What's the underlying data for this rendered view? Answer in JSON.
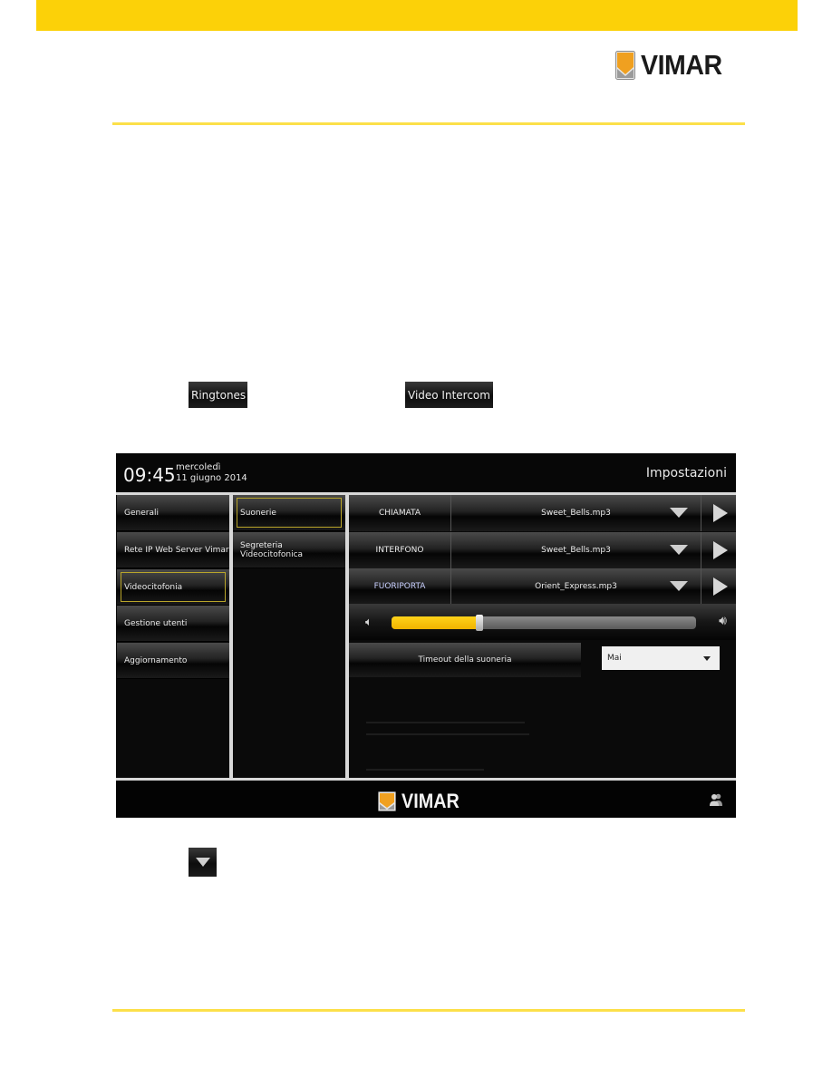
{
  "document": {
    "brand": "VIMAR",
    "inline_buttons": {
      "ringtones": "Ringtones",
      "video_intercom": "Video Intercom",
      "dropdown_icon": "chevron-down-icon"
    },
    "colors": {
      "brand_yellow": "#fcd108",
      "rule_yellow": "#fce04a"
    }
  },
  "device": {
    "status_bar": {
      "time": "09:45",
      "weekday": "mercoledì",
      "date": "11 giugno 2014",
      "title": "Impostazioni"
    },
    "main_menu": [
      {
        "label": "Generali",
        "selected": false
      },
      {
        "label": "Rete IP Web Server Vimar",
        "selected": false
      },
      {
        "label": "Videocitofonia",
        "selected": true
      },
      {
        "label": "Gestione utenti",
        "selected": false
      },
      {
        "label": "Aggiornamento",
        "selected": false
      }
    ],
    "sub_menu": [
      {
        "label": "Suonerie",
        "selected": true
      },
      {
        "label": "Segreteria Videocitofonica",
        "selected": false
      }
    ],
    "ringtones": [
      {
        "label": "CHIAMATA",
        "file": "Sweet_Bells.mp3"
      },
      {
        "label": "INTERFONO",
        "file": "Sweet_Bells.mp3"
      },
      {
        "label": "FUORIPORTA",
        "file": "Orient_Express.mp3"
      }
    ],
    "volume": {
      "level_percent": 29
    },
    "timeout": {
      "label": "Timeout della suoneria",
      "value": "Mai"
    },
    "footer": {
      "brand": "VIMAR",
      "users_icon": "users-icon"
    }
  }
}
